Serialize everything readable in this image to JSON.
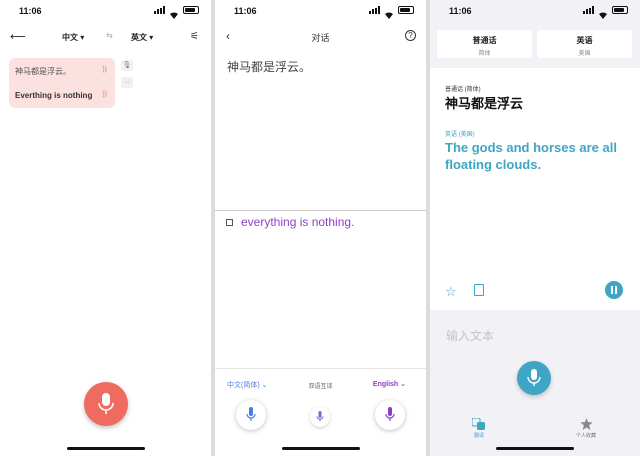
{
  "status_time": "11:06",
  "panel1": {
    "source_lang": "中文 ▾",
    "target_lang": "英文 ▾",
    "swap_icon": "⇆",
    "source_text": "神马都是浮云。",
    "translated_text": "Everthing is nothing",
    "accent": "#ef6b60"
  },
  "panel2": {
    "title": "对话",
    "help": "?",
    "source_text": "神马都是浮云。",
    "translated_text": "everything is nothing.",
    "left_lang": "中文(简体) ⌄",
    "mode_label": "双语互译",
    "right_lang": "English ⌄",
    "accent_left": "#4a7de0",
    "accent_right": "#8b3fc7"
  },
  "panel3": {
    "lang_left": {
      "name": "普通话",
      "sub": "简体"
    },
    "lang_right": {
      "name": "英语",
      "sub": "美国"
    },
    "source_label": "普通话 (简体)",
    "source_text": "神马都是浮云",
    "target_label": "英语 (美国)",
    "translated_text": "The gods and horses are all floating clouds.",
    "input_placeholder": "输入文本",
    "tab_translate": "翻译",
    "tab_favorites": "个人收藏",
    "accent": "#3ea6c4"
  }
}
